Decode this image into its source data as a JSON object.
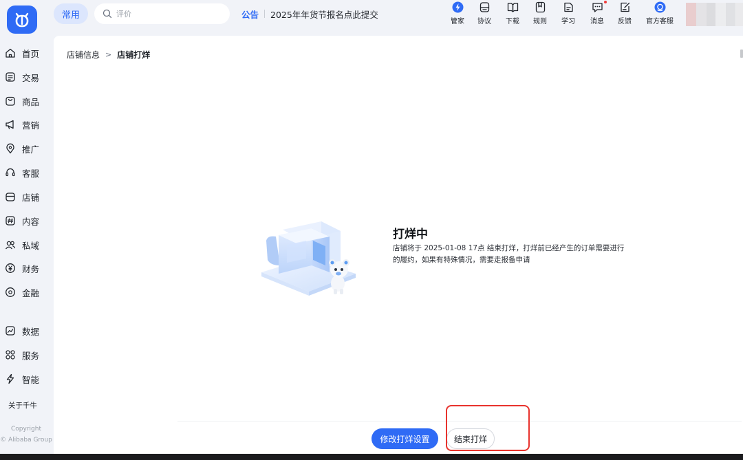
{
  "header": {
    "common_label": "常用",
    "search": {
      "placeholder": "评价"
    },
    "notice": {
      "tag": "公告",
      "text": "2025年年货节报名点此提交"
    },
    "tools": [
      {
        "label": "管家"
      },
      {
        "label": "协议"
      },
      {
        "label": "下载"
      },
      {
        "label": "规则"
      },
      {
        "label": "学习"
      },
      {
        "label": "消息"
      },
      {
        "label": "反馈"
      },
      {
        "label": "官方客服"
      }
    ]
  },
  "sidebar": {
    "items": [
      {
        "label": "首页"
      },
      {
        "label": "交易"
      },
      {
        "label": "商品"
      },
      {
        "label": "营销"
      },
      {
        "label": "推广"
      },
      {
        "label": "客服"
      },
      {
        "label": "店铺"
      },
      {
        "label": "内容"
      },
      {
        "label": "私域"
      },
      {
        "label": "财务"
      },
      {
        "label": "金融"
      },
      {
        "label": "数据"
      },
      {
        "label": "服务"
      },
      {
        "label": "智能"
      }
    ],
    "about": "关于千牛",
    "copyright": "Copyright",
    "company": "© Alibaba Group"
  },
  "breadcrumb": {
    "parent": "店铺信息",
    "separator": ">",
    "current": "店铺打烊"
  },
  "status": {
    "title": "打烊中",
    "description": "店铺将于 2025-01-08 17点 结束打烊，打烊前已经产生的订单需要进行的履约，如果有特殊情况，需要走报备申请"
  },
  "actions": {
    "modify_label": "修改打烊设置",
    "end_label": "结束打烊"
  },
  "colors": {
    "primary": "#2f6bf5",
    "highlight": "#e8332d",
    "background": "#f1f3f8"
  }
}
